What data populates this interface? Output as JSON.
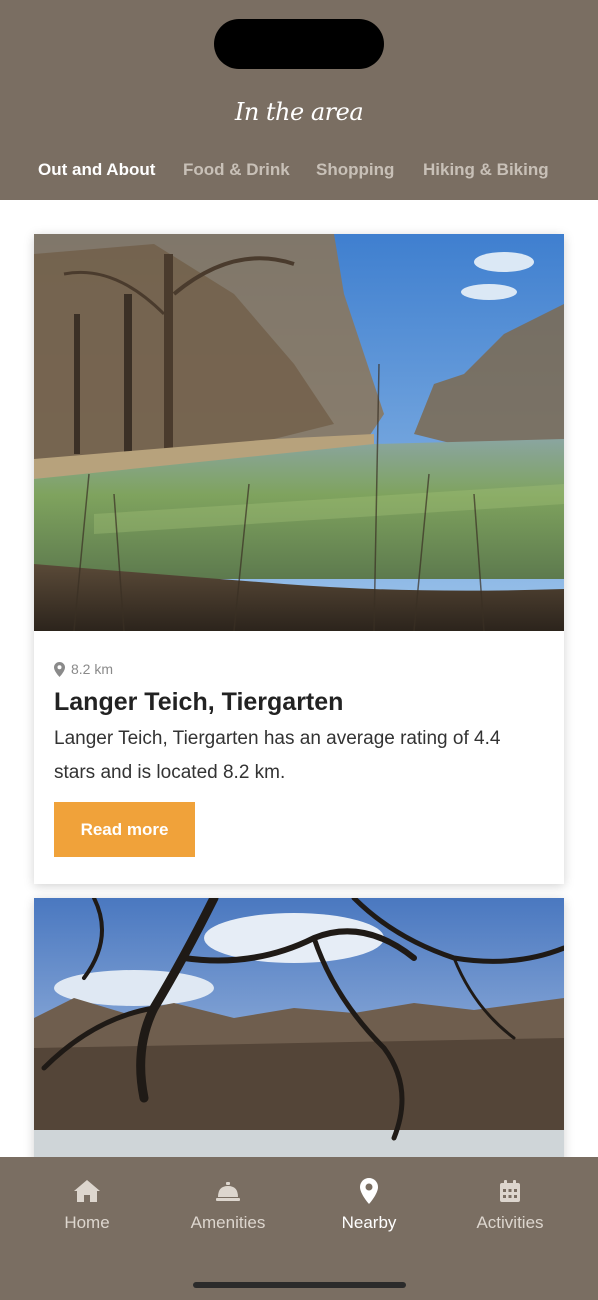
{
  "header": {
    "title": "In the area",
    "tabs": [
      {
        "label": "Out and About",
        "active": true
      },
      {
        "label": "Food & Drink",
        "active": false
      },
      {
        "label": "Shopping",
        "active": false
      },
      {
        "label": "Hiking & Biking",
        "active": false
      }
    ]
  },
  "cards": [
    {
      "distance": "8.2 km",
      "title": "Langer Teich, Tiergarten",
      "description": "Langer Teich, Tiergarten has an average rating of 4.4 stars and is located 8.2 km.",
      "button_label": "Read more",
      "image": "pond-landscape-photo"
    },
    {
      "image": "forest-pond-photo"
    }
  ],
  "bottom_nav": {
    "items": [
      {
        "label": "Home",
        "icon": "home-icon",
        "active": false
      },
      {
        "label": "Amenities",
        "icon": "service-bell-icon",
        "active": false
      },
      {
        "label": "Nearby",
        "icon": "map-pin-icon",
        "active": true
      },
      {
        "label": "Activities",
        "icon": "calendar-icon",
        "active": false
      }
    ]
  },
  "colors": {
    "header_bg": "#7a6e62",
    "accent": "#f0a23a",
    "active_text": "#ffffff",
    "inactive_text": "#c8c0b7"
  }
}
